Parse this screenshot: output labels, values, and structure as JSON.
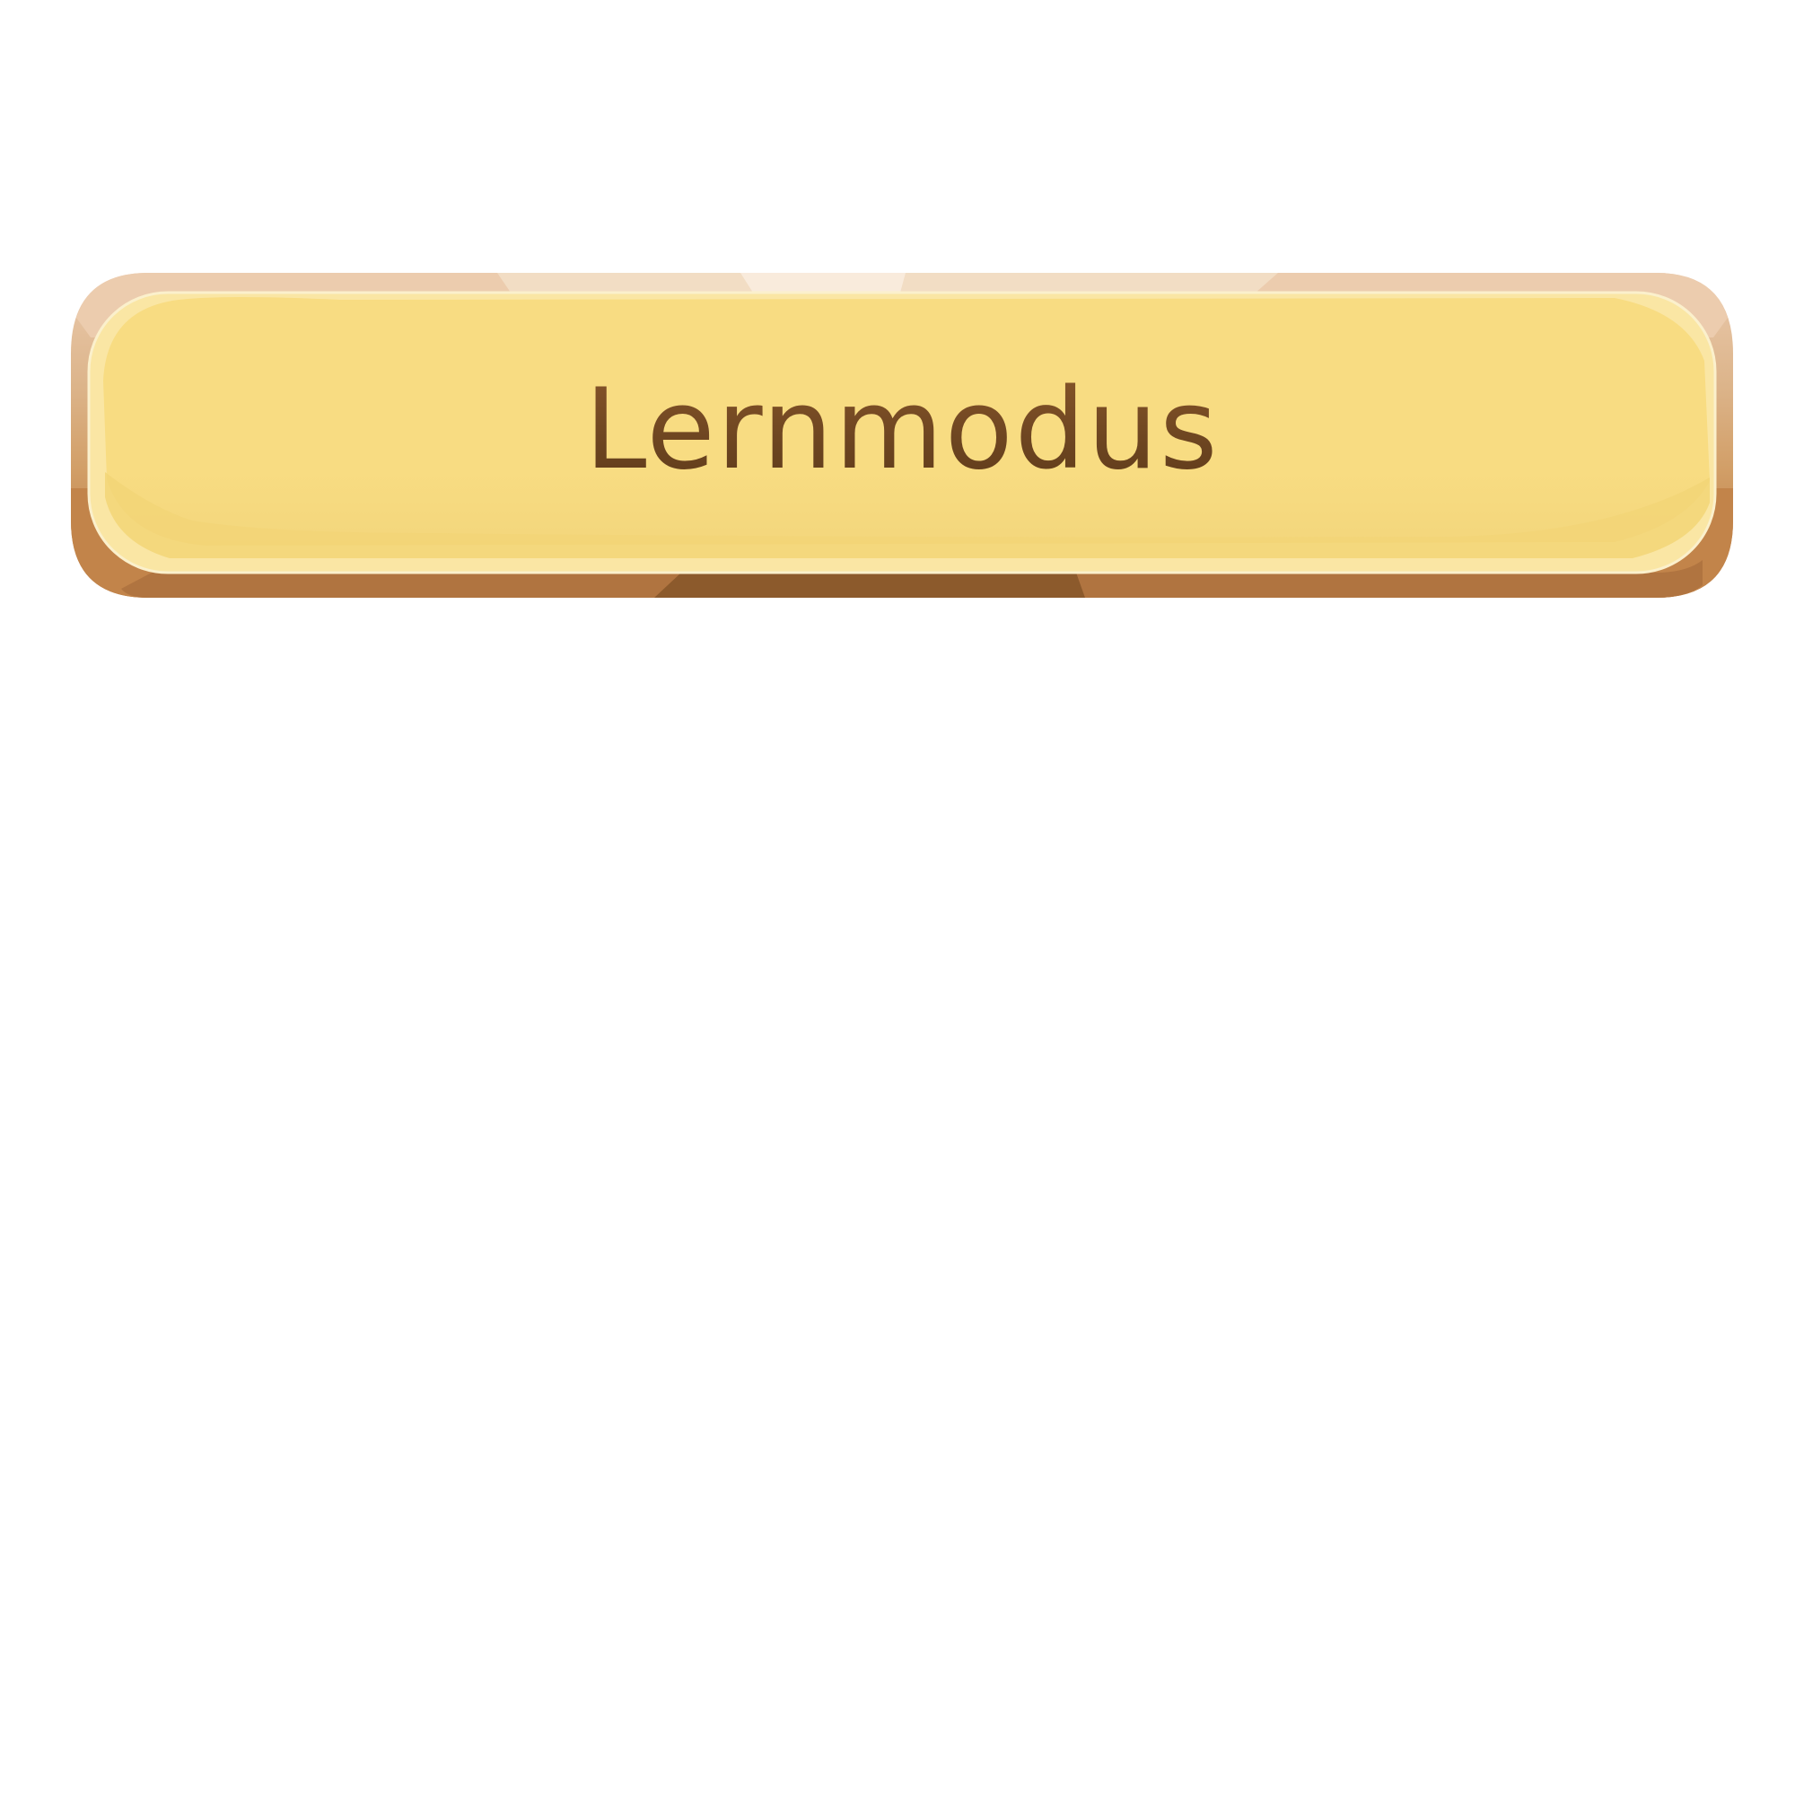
{
  "button": {
    "label": "Lernmodus"
  },
  "colors": {
    "page_background": "#ffffff",
    "face_fill": "#f8dc82",
    "face_highlight": "#fae6a4",
    "face_shadow": "#f2d577",
    "rim_top": "#ebcbae",
    "rim_side": "#d6a975",
    "rim_bottom": "#b9773d",
    "rim_dark": "#8c5a2c",
    "label_text": "#6b4420"
  }
}
